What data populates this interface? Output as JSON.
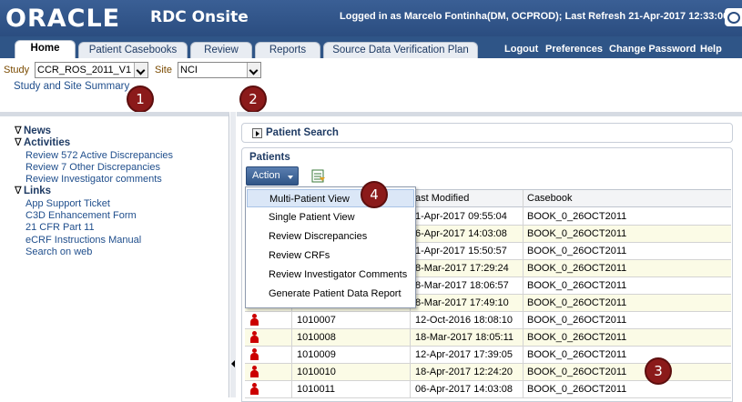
{
  "app": {
    "brand": "ORACLE",
    "product": "RDC Onsite",
    "logged_in": "Logged in as Marcelo Fontinha(DM, OCPROD); Last Refresh 21-Apr-2017 12:33:00"
  },
  "tabs": [
    "Home",
    "Patient Casebooks",
    "Review",
    "Reports",
    "Source Data Verification Plan"
  ],
  "top_links": [
    "Logout",
    "Preferences",
    "Change Password",
    "Help"
  ],
  "selectors": {
    "study_label": "Study",
    "study_value": "CCR_ROS_2011_V1",
    "site_label": "Site",
    "site_value": "NCI",
    "summary_link": "Study and Site Summary"
  },
  "badges": [
    "1",
    "2",
    "3",
    "4"
  ],
  "sidebar": {
    "news": "News",
    "activities": "Activities",
    "activity_items": [
      "Review 572 Active Discrepancies",
      "Review 7 Other Discrepancies",
      "Review Investigator comments"
    ],
    "links": "Links",
    "link_items": [
      "App Support Ticket",
      "C3D Enhancement Form",
      "21 CFR Part 11",
      "eCRF Instructions Manual",
      "Search on web"
    ]
  },
  "patient_search": {
    "title": "Patient Search"
  },
  "patients": {
    "title": "Patients",
    "action_label": "Action",
    "columns": [
      "ast Modified",
      "Casebook"
    ],
    "rows": [
      {
        "patient": "",
        "modified": "1-Apr-2017 09:55:04",
        "casebook": "BOOK_0_26OCT2011"
      },
      {
        "patient": "",
        "modified": "6-Apr-2017 14:03:08",
        "casebook": "BOOK_0_26OCT2011"
      },
      {
        "patient": "",
        "modified": "1-Apr-2017 15:50:57",
        "casebook": "BOOK_0_26OCT2011"
      },
      {
        "patient": "",
        "modified": "8-Mar-2017 17:29:24",
        "casebook": "BOOK_0_26OCT2011"
      },
      {
        "patient": "",
        "modified": "8-Mar-2017 18:06:57",
        "casebook": "BOOK_0_26OCT2011"
      },
      {
        "patient": "",
        "modified": "8-Mar-2017 17:49:10",
        "casebook": "BOOK_0_26OCT2011"
      },
      {
        "patient": "1010007",
        "modified": "12-Oct-2016 18:08:10",
        "casebook": "BOOK_0_26OCT2011"
      },
      {
        "patient": "1010008",
        "modified": "18-Mar-2017 18:05:11",
        "casebook": "BOOK_0_26OCT2011"
      },
      {
        "patient": "1010009",
        "modified": "12-Apr-2017 17:39:05",
        "casebook": "BOOK_0_26OCT2011"
      },
      {
        "patient": "1010010",
        "modified": "18-Apr-2017 12:24:20",
        "casebook": "BOOK_0_26OCT2011"
      },
      {
        "patient": "1010011",
        "modified": "06-Apr-2017 14:03:08",
        "casebook": "BOOK_0_26OCT2011"
      }
    ]
  },
  "action_menu": [
    "Multi-Patient View",
    "Single Patient View",
    "Review Discrepancies",
    "Review CRFs",
    "Review Investigator Comments",
    "Generate Patient Data Report"
  ]
}
